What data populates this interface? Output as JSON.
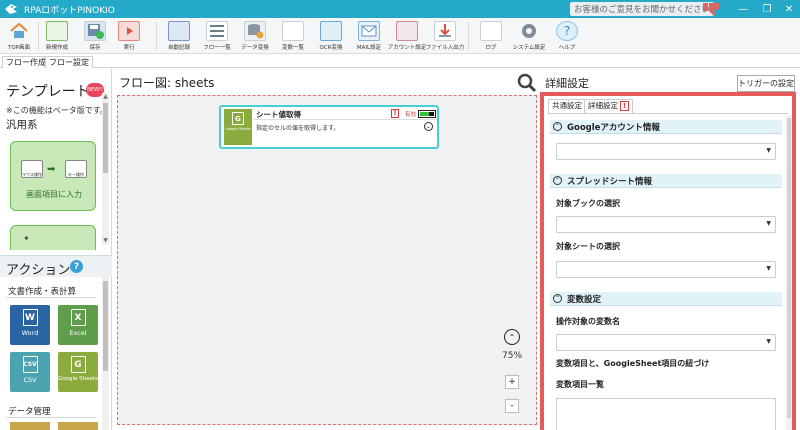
{
  "window": {
    "title": "RPAロボットPINOKIO",
    "feedback": "お客様のご意見をお聞かせください",
    "buttons": [
      "—",
      "❐",
      "✕"
    ]
  },
  "toolbar": {
    "items": [
      {
        "label": "TOP画面",
        "icon": "home-icon"
      },
      {
        "label": "新規作成",
        "icon": "new-file-icon"
      },
      {
        "label": "保存",
        "icon": "save-icon"
      },
      {
        "label": "実行",
        "icon": "run-icon"
      },
      {
        "label": "自動記録",
        "icon": "record-icon"
      },
      {
        "label": "フロー一覧",
        "icon": "flow-list-icon"
      },
      {
        "label": "データ変換",
        "icon": "database-icon"
      },
      {
        "label": "変数一覧",
        "icon": "variable-list-icon"
      },
      {
        "label": "OCR変換",
        "icon": "ocr-icon"
      },
      {
        "label": "MAIL設定",
        "icon": "mail-icon"
      },
      {
        "label": "アカウント設定",
        "icon": "account-icon"
      },
      {
        "label": "ファイル入出力",
        "icon": "file-io-icon"
      },
      {
        "label": "ログ",
        "icon": "log-icon"
      },
      {
        "label": "システム設定",
        "icon": "gear-icon"
      },
      {
        "label": "ヘルプ",
        "icon": "help-icon"
      }
    ]
  },
  "tabs": {
    "flow_create": "フロー作成",
    "flow_settings": "フロー設定"
  },
  "left": {
    "templates_title": "テンプレート",
    "new_badge": "NEW!!",
    "beta_note": "※この機能はベータ版です。",
    "generic": "汎用系",
    "template_card": "画面項目に入力",
    "card_left_icon": "マウス操作",
    "card_right_icon": "キー操作",
    "actions_title": "アクション",
    "help": "?",
    "category_docs": "文書作成・表計算",
    "category_data": "データ管理",
    "actions": [
      {
        "letter": "W",
        "name": "Word",
        "color": "#2b64a3"
      },
      {
        "letter": "X",
        "name": "Excel",
        "color": "#5e9e4a"
      },
      {
        "letter": "CSV",
        "name": "CSV",
        "color": "#4aa3ae"
      },
      {
        "letter": "G",
        "name": "Google Sheets",
        "color": "#8bab3e"
      }
    ]
  },
  "flow": {
    "title": "フロー図:  sheets",
    "node": {
      "title": "シート値取得",
      "warn": "!",
      "enabled": "有効",
      "description": "指定のセルの値を取得します。",
      "icon_letter": "G",
      "icon_caption": "Google Sheets"
    },
    "zoom": "75%",
    "zoom_in": "+",
    "zoom_out": "-"
  },
  "right": {
    "title": "詳細設定",
    "trigger_button": "トリガーの設定",
    "tab_common": "共通設定",
    "tab_detail": "詳細設定",
    "tab_warn": "!",
    "section_google": "Googleアカウント情報",
    "section_spreadsheet": "スプレッドシート情報",
    "label_book": "対象ブックの選択",
    "label_sheet": "対象シートの選択",
    "section_variables": "変数設定",
    "label_variable": "操作対象の変数名",
    "label_mapping": "変数項目と、GoogleSheet項目の紐づけ",
    "label_var_list": "変数項目一覧"
  },
  "colors": {
    "titlebar": "#24a9c9",
    "highlight_border": "#e35b5b",
    "node_border": "#47cfd6",
    "section_bg": "#e2f3f8"
  }
}
